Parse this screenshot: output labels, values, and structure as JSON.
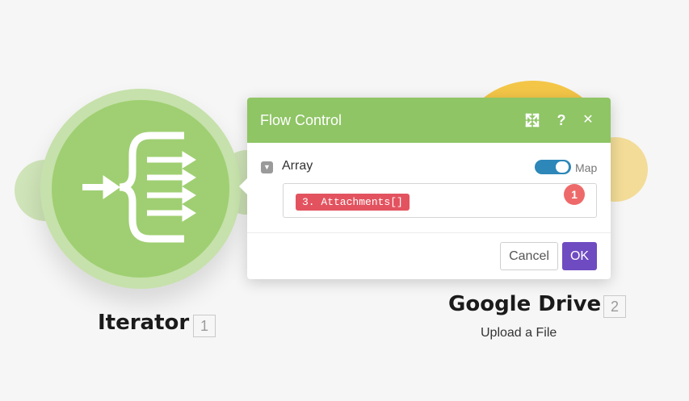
{
  "iterator": {
    "title": "Iterator",
    "number": "1"
  },
  "google_drive": {
    "title": "Google Drive",
    "number": "2",
    "subtitle": "Upload a File"
  },
  "dialog": {
    "title": "Flow Control",
    "icons": {
      "expand": "expand-icon",
      "help": "?",
      "close": "✕"
    },
    "field": {
      "label": "Array",
      "map_label": "Map",
      "map_enabled": true,
      "value_pill": "3. Attachments[]",
      "badge": "1"
    },
    "buttons": {
      "cancel": "Cancel",
      "ok": "OK"
    }
  },
  "colors": {
    "iterator_green": "#9fcf72",
    "dialog_header": "#8fc565",
    "google_drive_yellow": "#f4c648",
    "pill_red": "#e3535f",
    "ok_purple": "#6f4bc1",
    "toggle_blue": "#2d87b9"
  }
}
